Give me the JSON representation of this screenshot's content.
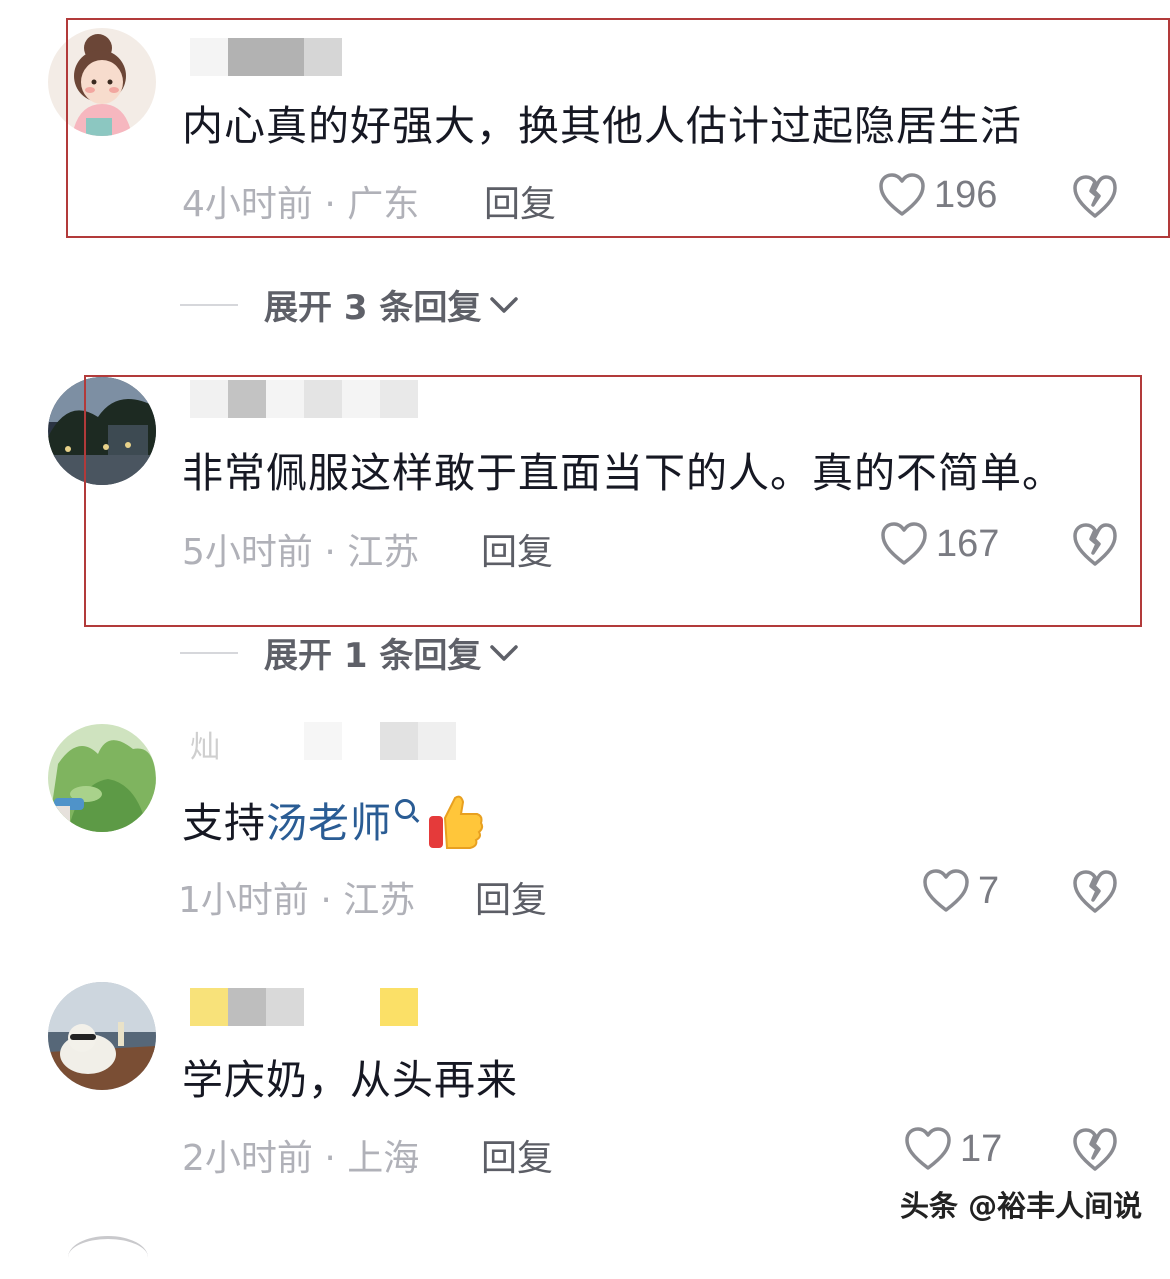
{
  "comments": [
    {
      "text": "内心真的好强大，换其他人估计过起隐居生活",
      "meta": "4小时前 · 广东",
      "reply_label": "回复",
      "likes": "196",
      "expand_label": "展开 3 条回复"
    },
    {
      "text": "非常佩服这样敢于直面当下的人。真的不简单。",
      "meta": "5小时前 · 江苏",
      "reply_label": "回复",
      "likes": "167",
      "expand_label": "展开 1 条回复"
    },
    {
      "text_prefix": "支持",
      "mention": "汤老师",
      "meta": "1小时前 · 江苏",
      "reply_label": "回复",
      "likes": "7"
    },
    {
      "text": "学庆奶，从头再来",
      "meta": "2小时前 · 上海",
      "reply_label": "回复",
      "likes": "17"
    }
  ],
  "watermark": "头条 @裕丰人间说",
  "icons": {
    "like": "heart-outline-icon",
    "dislike": "broken-heart-icon",
    "expand": "chevron-down-icon",
    "mention_search": "search-icon",
    "emoji": "thumbs-up-emoji-icon"
  },
  "colors": {
    "highlight_box": "#b23a3a",
    "mention": "#2a5c94",
    "meta_text": "#b0b1b8"
  }
}
